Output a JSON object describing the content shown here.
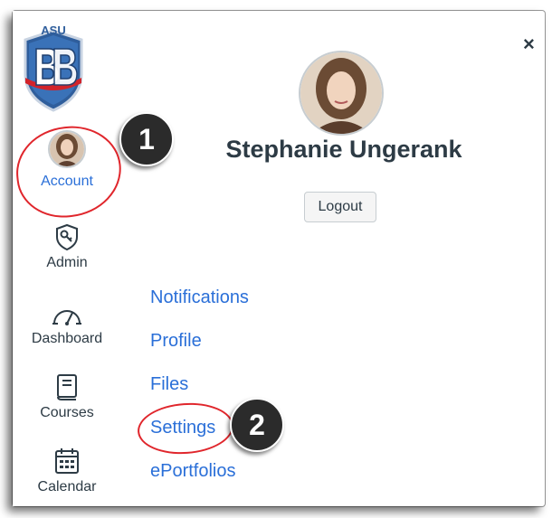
{
  "logo": {
    "text": "ASU"
  },
  "close": {
    "symbol": "×"
  },
  "nav": {
    "items": [
      {
        "label": "Account"
      },
      {
        "label": "Admin"
      },
      {
        "label": "Dashboard"
      },
      {
        "label": "Courses"
      },
      {
        "label": "Calendar"
      }
    ]
  },
  "annotations": {
    "badge1": "1",
    "badge2": "2"
  },
  "profile": {
    "name": "Stephanie Ungerank",
    "logout_label": "Logout"
  },
  "links": [
    {
      "label": "Notifications"
    },
    {
      "label": "Profile"
    },
    {
      "label": "Files"
    },
    {
      "label": "Settings"
    },
    {
      "label": "ePortfolios"
    }
  ],
  "colors": {
    "link": "#2a6fd8",
    "text": "#2d3b45",
    "highlight": "#e0262c",
    "badge": "#2b2b2b"
  }
}
